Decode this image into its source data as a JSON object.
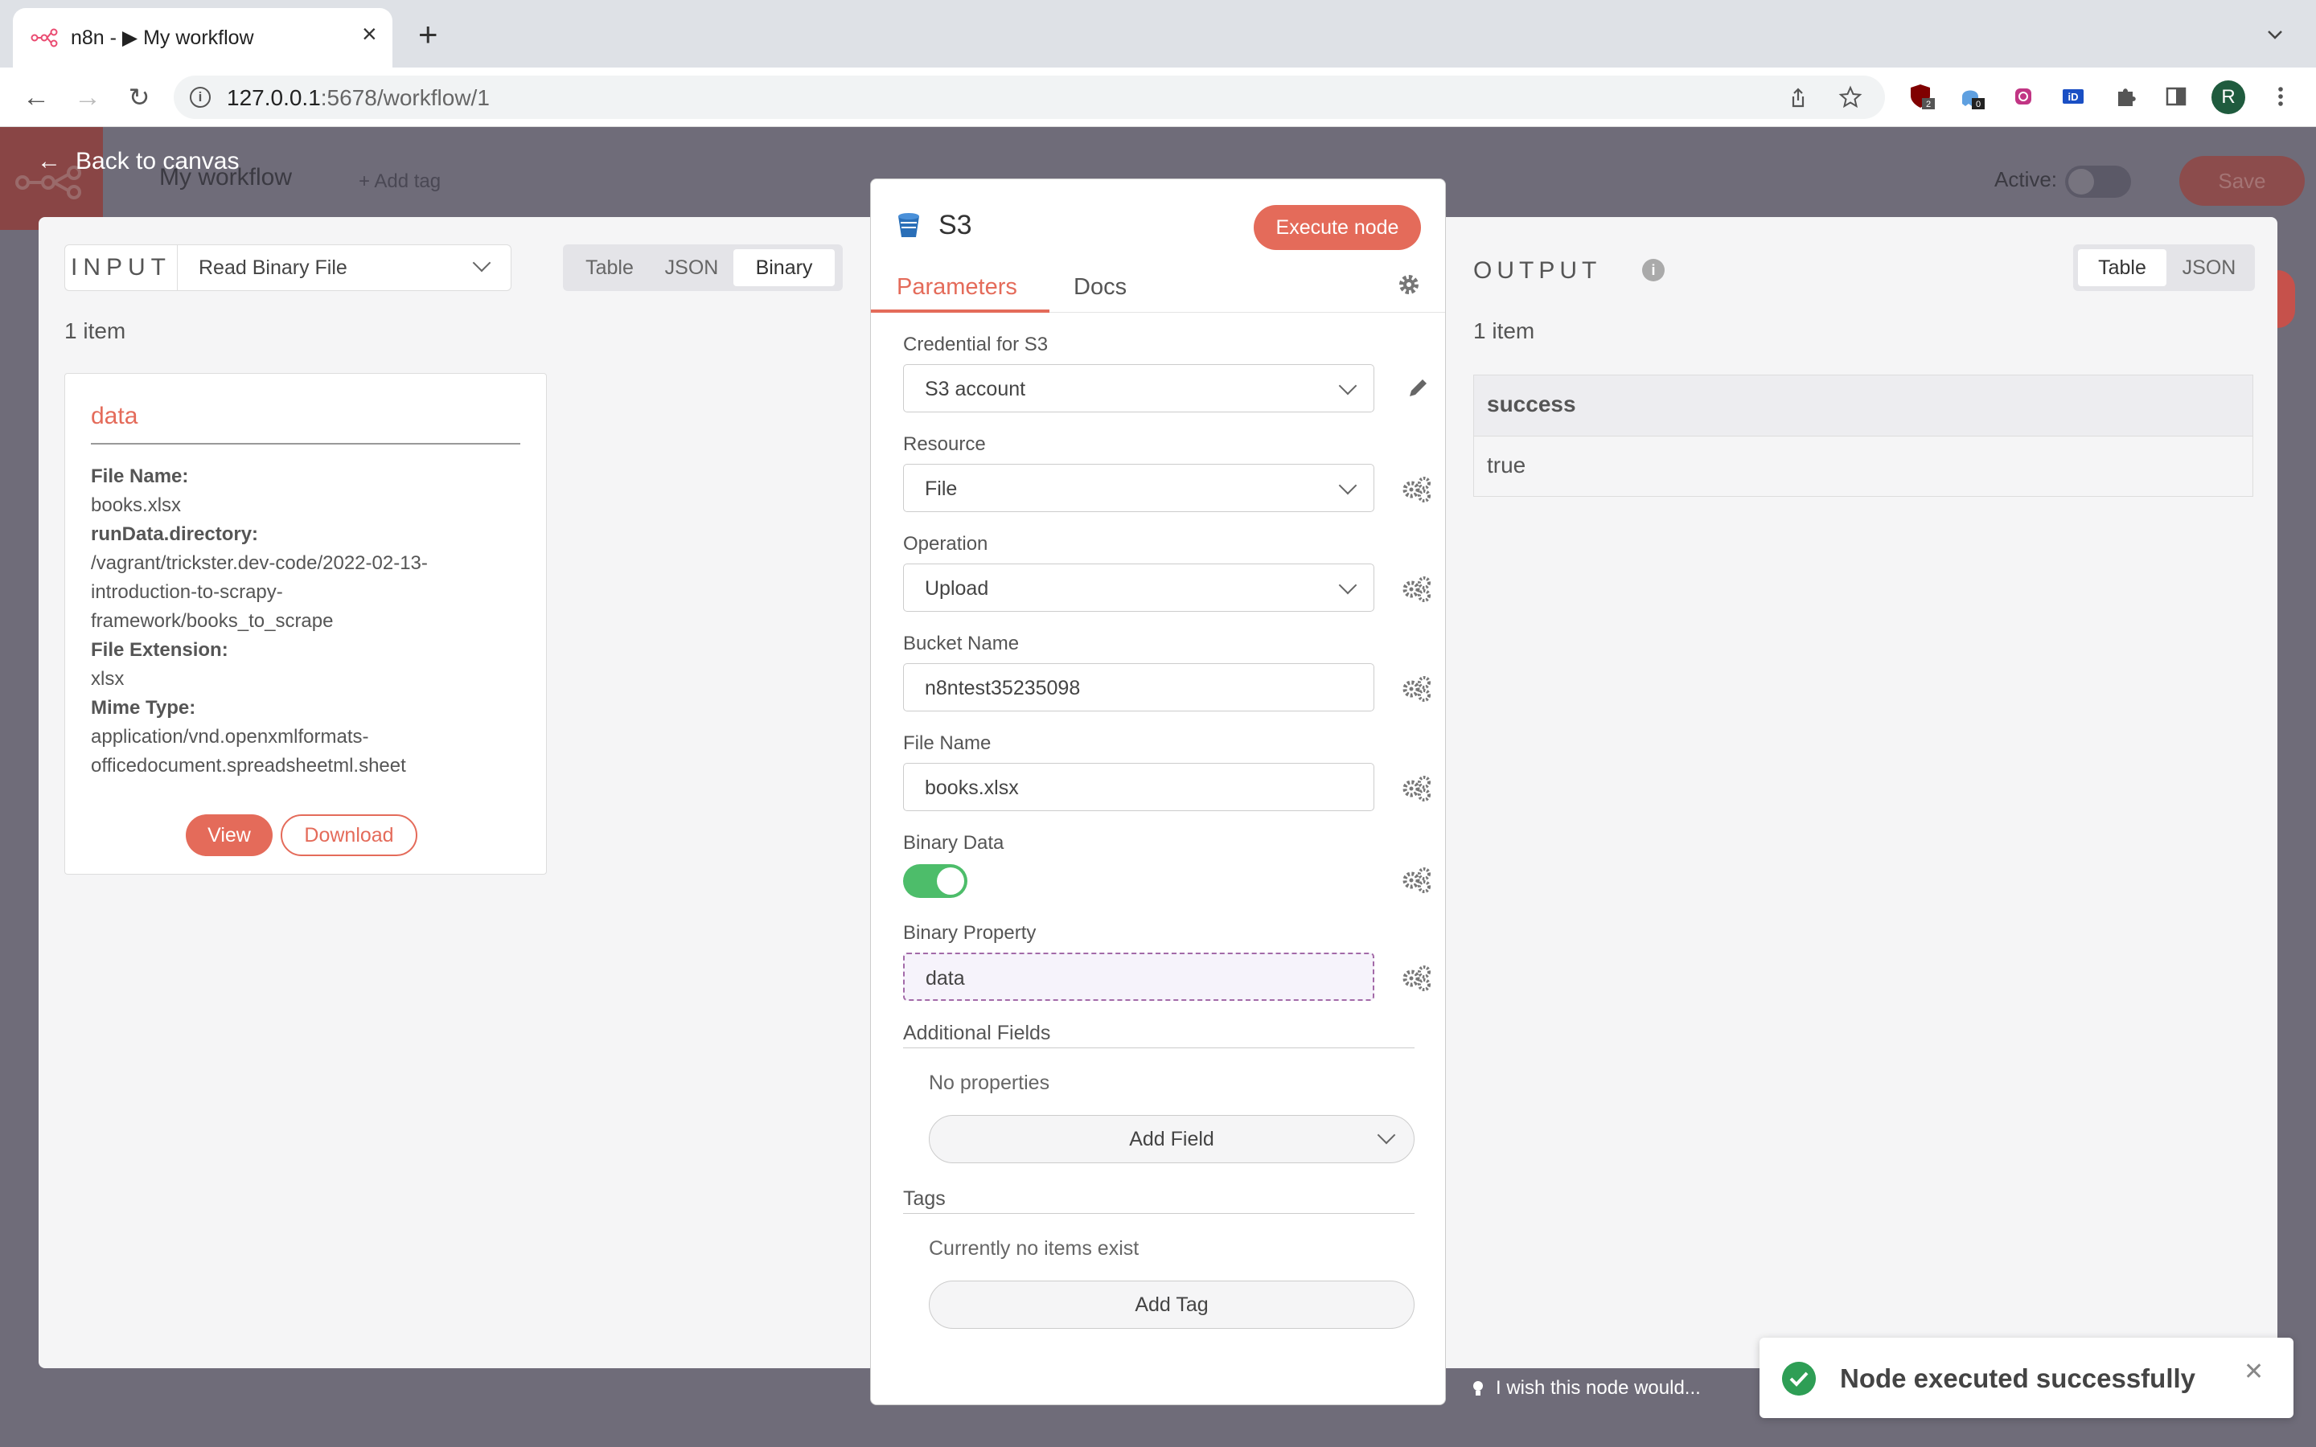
{
  "browser": {
    "tab_title": "n8n - ▶ My workflow",
    "url_host": "127.0.0.1",
    "url_rest": ":5678/workflow/1",
    "profile_initial": "R",
    "ext_badge_1": "2",
    "ext_badge_2": "0"
  },
  "header": {
    "back_label": "Back to canvas",
    "workflow_name": "My workflow",
    "add_tag": "+ Add tag",
    "active_label": "Active:",
    "save_label": "Save"
  },
  "input": {
    "label": "INPUT",
    "node": "Read Binary File",
    "modes": [
      "Table",
      "JSON",
      "Binary"
    ],
    "selected_mode": "Binary",
    "count": "1 item",
    "card": {
      "title": "data",
      "fields": [
        {
          "key": "File Name:",
          "value": "books.xlsx"
        },
        {
          "key": "runData.directory:",
          "value": "/vagrant/trickster.dev-code/2022-02-13-introduction-to-scrapy-framework/books_to_scrape"
        },
        {
          "key": "File Extension:",
          "value": "xlsx"
        },
        {
          "key": "Mime Type:",
          "value": "application/vnd.openxmlformats-officedocument.spreadsheetml.sheet"
        }
      ],
      "view_label": "View",
      "download_label": "Download"
    }
  },
  "node": {
    "title": "S3",
    "execute_label": "Execute node",
    "tabs": [
      "Parameters",
      "Docs"
    ],
    "credential_label": "Credential for S3",
    "credential_value": "S3 account",
    "resource_label": "Resource",
    "resource_value": "File",
    "operation_label": "Operation",
    "operation_value": "Upload",
    "bucket_label": "Bucket Name",
    "bucket_value": "n8ntest35235098",
    "filename_label": "File Name",
    "filename_value": "books.xlsx",
    "binary_data_label": "Binary Data",
    "binary_data_on": true,
    "binary_property_label": "Binary Property",
    "binary_property_value": "data",
    "additional_fields_label": "Additional Fields",
    "no_properties": "No properties",
    "add_field": "Add Field",
    "tags_label": "Tags",
    "no_items": "Currently no items exist",
    "add_tag": "Add Tag"
  },
  "output": {
    "label": "OUTPUT",
    "modes": [
      "Table",
      "JSON"
    ],
    "selected_mode": "Table",
    "count": "1 item",
    "column": "success",
    "value": "true"
  },
  "footer": {
    "wish": "I wish this node would...",
    "toast": "Node executed successfully"
  },
  "colors": {
    "accent": "#e46b5a",
    "success": "#4dbd6a"
  }
}
